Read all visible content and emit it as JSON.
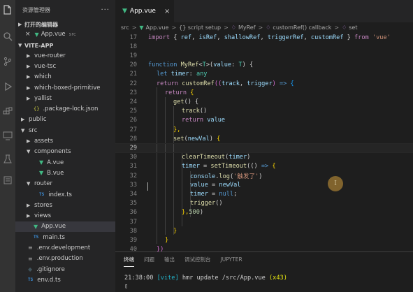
{
  "activity_bar": {
    "icons": [
      "files-icon",
      "search-icon",
      "source-control-icon",
      "run-debug-icon",
      "extensions-icon",
      "remote-icon",
      "testing-icon",
      "docker-icon"
    ]
  },
  "sidebar": {
    "title": "资源管理器",
    "more": "···",
    "open_editors_label": "打开的编辑器",
    "open_editor": {
      "name": "App.vue",
      "tag": "src"
    },
    "project_label": "VITE-APP",
    "items": [
      {
        "label": "vue-router",
        "type": "folder",
        "indent": 1
      },
      {
        "label": "vue-tsc",
        "type": "folder",
        "indent": 1
      },
      {
        "label": "which",
        "type": "folder",
        "indent": 1
      },
      {
        "label": "which-boxed-primitive",
        "type": "folder",
        "indent": 1
      },
      {
        "label": "yallist",
        "type": "folder",
        "indent": 1
      },
      {
        "label": ".package-lock.json",
        "type": "json",
        "indent": 1
      },
      {
        "label": "public",
        "type": "folder",
        "indent": 0
      },
      {
        "label": "src",
        "type": "folder-open",
        "indent": 0
      },
      {
        "label": "assets",
        "type": "folder",
        "indent": 1
      },
      {
        "label": "components",
        "type": "folder-open",
        "indent": 1
      },
      {
        "label": "A.vue",
        "type": "vue",
        "indent": 2
      },
      {
        "label": "B.vue",
        "type": "vue",
        "indent": 2
      },
      {
        "label": "router",
        "type": "folder-open",
        "indent": 1
      },
      {
        "label": "index.ts",
        "type": "ts",
        "indent": 2
      },
      {
        "label": "stores",
        "type": "folder",
        "indent": 1
      },
      {
        "label": "views",
        "type": "folder",
        "indent": 1
      },
      {
        "label": "App.vue",
        "type": "vue",
        "indent": 1,
        "active": true
      },
      {
        "label": "main.ts",
        "type": "ts",
        "indent": 1
      },
      {
        "label": ".env.development",
        "type": "lines",
        "indent": 0
      },
      {
        "label": ".env.production",
        "type": "lines",
        "indent": 0
      },
      {
        "label": ".gitignore",
        "type": "git",
        "indent": 0
      },
      {
        "label": "env.d.ts",
        "type": "ts",
        "indent": 0
      }
    ],
    "ts_badge": "TS",
    "json_badge": "{}"
  },
  "editor": {
    "tab": {
      "label": "App.vue",
      "close": "×"
    },
    "breadcrumb": [
      "src",
      "App.vue",
      "{} script setup",
      "MyRef",
      "customRef() callback",
      "set"
    ],
    "line_numbers": [
      "17",
      "18",
      "19",
      "20",
      "21",
      "22",
      "23",
      "24",
      "25",
      "26",
      "27",
      "28",
      "29",
      "30",
      "31",
      "32",
      "33",
      "34",
      "35",
      "36",
      "37",
      "38",
      "39",
      "40"
    ],
    "code": {
      "l17": [
        "import",
        " { ",
        "ref",
        ", ",
        "isRef",
        ", ",
        "shallowRef",
        ", ",
        "triggerRef",
        ", ",
        "customRef",
        " } ",
        "from",
        " ",
        "'vue'"
      ],
      "l20": [
        "function",
        " ",
        "MyRef",
        "<",
        "T",
        ">(",
        "value",
        ": ",
        "T",
        ") {"
      ],
      "l21": [
        "let",
        " ",
        "timer",
        ": ",
        "any"
      ],
      "l22": [
        "return",
        " ",
        "customRef",
        "((",
        "track",
        ", ",
        "trigger",
        ") ",
        "=>",
        " {"
      ],
      "l23": [
        "return",
        " {"
      ],
      "l24": [
        "get",
        "() {"
      ],
      "l25": [
        "track",
        "()"
      ],
      "l26": [
        "return",
        " ",
        "value"
      ],
      "l27": [
        "},"
      ],
      "l28": [
        "set",
        "(",
        "newVal",
        ") ",
        "{"
      ],
      "l30": [
        "clearTimeout",
        "(",
        "timer",
        ")"
      ],
      "l31": [
        "timer",
        " = ",
        "setTimeout",
        "(() ",
        "=>",
        " {"
      ],
      "l32": [
        "console",
        ".",
        "log",
        "(",
        "'触发了'",
        ")"
      ],
      "l33": [
        "value",
        " = ",
        "newVal"
      ],
      "l34": [
        "timer",
        " = ",
        "null",
        ";"
      ],
      "l35": [
        "trigger",
        "()"
      ],
      "l36": [
        "},",
        "500",
        ")"
      ],
      "l38": [
        "}"
      ],
      "l39": [
        "}"
      ],
      "l40": [
        "})"
      ]
    },
    "mouse_cursor": "I"
  },
  "panel": {
    "tabs": [
      "终端",
      "问题",
      "输出",
      "调试控制台",
      "JUPYTER"
    ],
    "active_tab": "终端",
    "terminal": {
      "time": "21:38:00",
      "tag": "[vite]",
      "message": " hmr update /src/App.vue ",
      "count": "(x43)",
      "prompt": "▯"
    }
  }
}
